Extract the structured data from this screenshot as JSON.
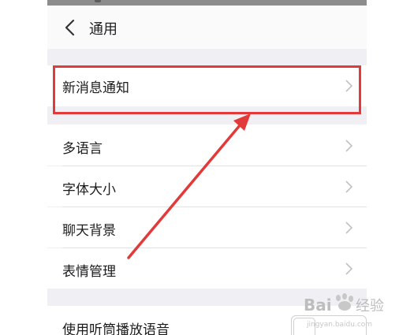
{
  "header": {
    "title": "通用"
  },
  "settings_group1": [
    {
      "label": "新消息通知"
    }
  ],
  "settings_group2": [
    {
      "label": "多语言"
    },
    {
      "label": "字体大小"
    },
    {
      "label": "聊天背景"
    },
    {
      "label": "表情管理"
    }
  ],
  "settings_group3": [
    {
      "label": "使用听筒播放语音",
      "toggle_on": false
    }
  ],
  "annotation": {
    "highlight_color": "#e23a3a",
    "arrow_color": "#e23a3a"
  },
  "watermark": {
    "text_latin": "Bai",
    "text_cn": "经验",
    "domain": "jingyan.baidu.com"
  }
}
